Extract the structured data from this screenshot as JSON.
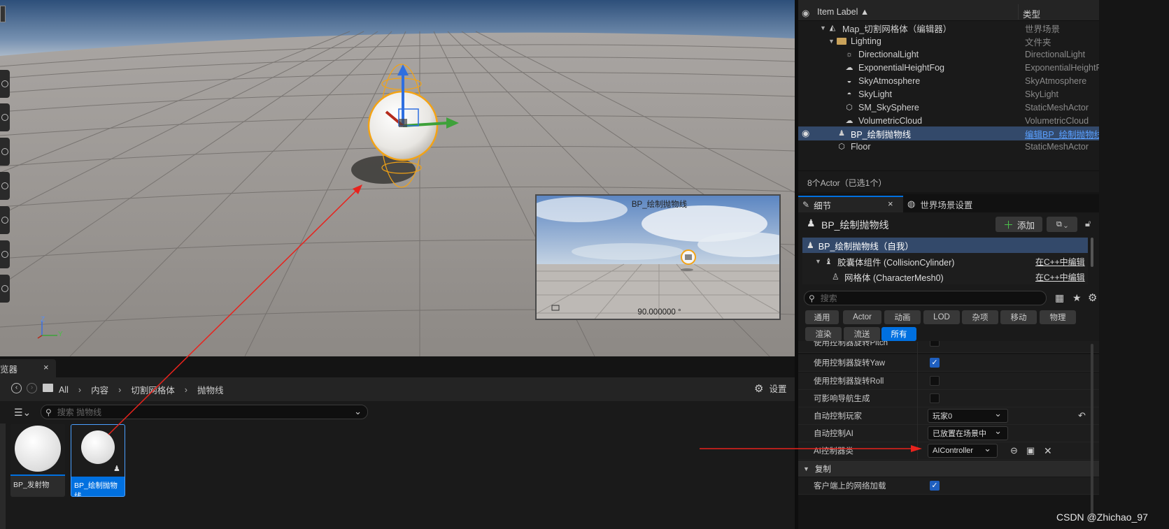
{
  "viewport": {
    "preview_title": "BP_绘制抛物线",
    "preview_angle": "90.000000 °",
    "axis_x": "Y",
    "axis_z": "Z"
  },
  "outliner": {
    "col_label": "Item Label ▲",
    "col_type": "类型",
    "rows": [
      {
        "label": "Map_切割网格体（编辑器）",
        "type": "世界场景"
      },
      {
        "label": "Lighting",
        "type": "文件夹"
      },
      {
        "label": "DirectionalLight",
        "type": "DirectionalLight"
      },
      {
        "label": "ExponentialHeightFog",
        "type": "ExponentialHeightF"
      },
      {
        "label": "SkyAtmosphere",
        "type": "SkyAtmosphere"
      },
      {
        "label": "SkyLight",
        "type": "SkyLight"
      },
      {
        "label": "SM_SkySphere",
        "type": "StaticMeshActor"
      },
      {
        "label": "VolumetricCloud",
        "type": "VolumetricCloud"
      },
      {
        "label": "BP_绘制抛物线",
        "type": "编辑BP_绘制抛物线"
      },
      {
        "label": "Floor",
        "type": "StaticMeshActor"
      }
    ],
    "status": "8个Actor（已选1个）"
  },
  "details": {
    "tab_details": "细节",
    "tab_world": "世界场景设置",
    "actor_name": "BP_绘制抛物线",
    "add_label": "添加",
    "components": [
      {
        "label": "BP_绘制抛物线（自我）",
        "edit": ""
      },
      {
        "label": "胶囊体组件 (CollisionCylinder)",
        "edit": "在C++中编辑"
      },
      {
        "label": "网格体 (CharacterMesh0)",
        "edit": "在C++中编辑"
      }
    ],
    "search_placeholder": "搜索",
    "categories_row1": [
      "通用",
      "Actor",
      "动画",
      "LOD",
      "杂项",
      "移动",
      "物理"
    ],
    "categories_row2": [
      "渲染",
      "流送",
      "所有"
    ],
    "partial_label": "使用控制器旋转Pitch",
    "props": [
      {
        "label": "使用控制器旋转Yaw",
        "kind": "check",
        "checked": true
      },
      {
        "label": "使用控制器旋转Roll",
        "kind": "check",
        "checked": false
      },
      {
        "label": "可影响导航生成",
        "kind": "check",
        "checked": false
      },
      {
        "label": "自动控制玩家",
        "kind": "combo",
        "value": "玩家0"
      },
      {
        "label": "自动控制AI",
        "kind": "combo",
        "value": "已放置在场景中"
      },
      {
        "label": "AI控制器类",
        "kind": "combo",
        "value": "AIController"
      }
    ],
    "section_replication": "复制",
    "net_load_label": "客户端上的网络加载"
  },
  "content_browser": {
    "tab_label": "览器",
    "breadcrumb": [
      "All",
      "内容",
      "切割网格体",
      "抛物线"
    ],
    "settings_label": "设置",
    "search_placeholder": "搜索 抛物线",
    "assets": [
      {
        "label": "BP_发射物"
      },
      {
        "label": "BP_绘制抛物线"
      }
    ]
  },
  "watermark": "CSDN @Zhichao_97",
  "colors": {
    "accent": "#0070e0",
    "selection": "#33496a",
    "annotation_arrow": "#e8231d"
  }
}
